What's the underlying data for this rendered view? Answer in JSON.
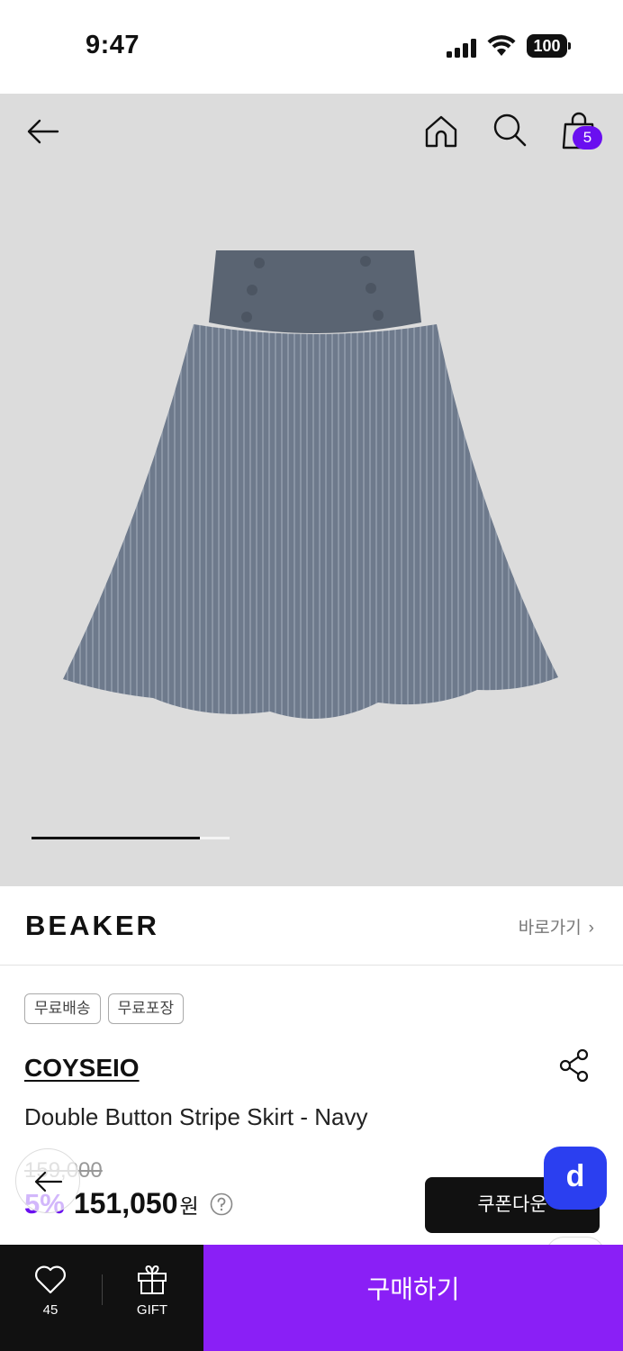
{
  "status_bar": {
    "time": "9:47",
    "battery": "100"
  },
  "header": {
    "cart_count": "5"
  },
  "gallery": {
    "current_index": 1,
    "total_images": 2
  },
  "brand_row": {
    "logo": "BEAKER",
    "link_label": "바로가기",
    "link_chevron": "›"
  },
  "tags": [
    "무료배송",
    "무료포장"
  ],
  "product": {
    "brand": "COYSEIO",
    "name": "Double Button Stripe Skirt - Navy",
    "original_price": "159,000",
    "discount": "5%",
    "sale_price": "151,050",
    "currency": "원"
  },
  "coupon_button": "쿠폰다운",
  "floating": {
    "d_label": "d"
  },
  "bottom_bar": {
    "like_count": "45",
    "gift_label": "GIFT",
    "buy_label": "구매하기"
  },
  "colors": {
    "accent_purple": "#8a1ff6",
    "badge_purple": "#6a0ff0",
    "d_button_blue": "#2b3ff0",
    "image_bg": "#dcdcdc"
  }
}
